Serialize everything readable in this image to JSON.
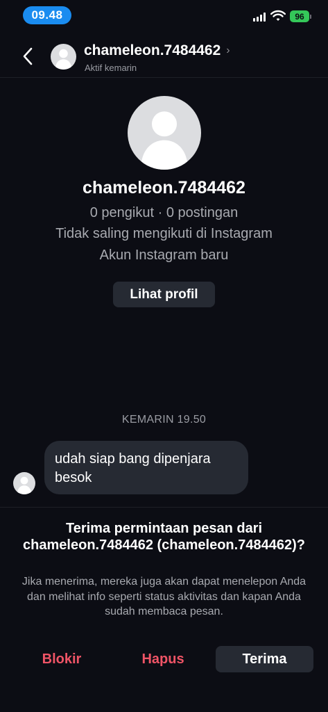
{
  "status_bar": {
    "time": "09.48",
    "battery": "96"
  },
  "header": {
    "username": "chameleon.7484462",
    "status": "Aktif kemarin"
  },
  "profile": {
    "username": "chameleon.7484462",
    "stats": "0 pengikut · 0 postingan",
    "follow_status": "Tidak saling mengikuti di Instagram",
    "account_note": "Akun Instagram baru",
    "view_profile_label": "Lihat profil"
  },
  "chat": {
    "timestamp": "KEMARIN 19.50",
    "messages": [
      {
        "text": "udah siap bang dipenjara besok"
      }
    ]
  },
  "request": {
    "title": "Terima permintaan pesan dari chameleon.7484462 (chameleon.7484462)?",
    "description": "Jika menerima, mereka juga akan dapat menelepon Anda dan melihat info seperti status aktivitas dan kapan Anda sudah membaca pesan."
  },
  "actions": {
    "block": "Blokir",
    "delete": "Hapus",
    "accept": "Terima"
  },
  "colors": {
    "background": "#0c0d14",
    "danger": "#ef5466",
    "button": "#262a33",
    "time_pill": "#1a8cf0",
    "battery": "#34c759"
  },
  "icons": [
    "back-chevron-icon",
    "avatar-placeholder-icon",
    "signal-icon",
    "wifi-icon",
    "battery-icon",
    "chevron-right-icon"
  ]
}
